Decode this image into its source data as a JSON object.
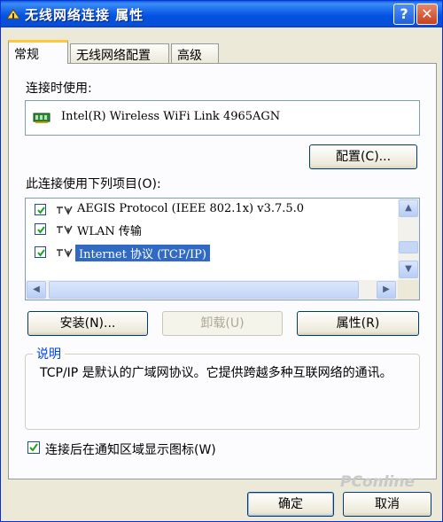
{
  "window": {
    "title": "无线网络连接 属性",
    "help_glyph": "?",
    "close_glyph": "✕"
  },
  "tabs": [
    {
      "label": "常规",
      "active": true
    },
    {
      "label": "无线网络配置",
      "active": false
    },
    {
      "label": "高级",
      "active": false
    }
  ],
  "general": {
    "connect_using_label": "连接时使用:",
    "device_name": "Intel(R) Wireless WiFi Link 4965AGN",
    "configure_button": "配置(C)...",
    "items_label": "此连接使用下列项目(O):",
    "items": [
      {
        "label": "AEGIS Protocol (IEEE 802.1x) v3.7.5.0",
        "checked": true,
        "selected": false
      },
      {
        "label": "WLAN 传输",
        "checked": true,
        "selected": false
      },
      {
        "label": "Internet 协议 (TCP/IP)",
        "checked": true,
        "selected": true
      }
    ],
    "install_button": "安装(N)...",
    "uninstall_button": "卸载(U)",
    "properties_button": "属性(R)",
    "description_title": "说明",
    "description_text": "TCP/IP 是默认的广域网协议。它提供跨越多种互联网络的通讯。",
    "show_icon_label": "连接后在通知区域显示图标(W)",
    "show_icon_checked": true
  },
  "footer": {
    "ok_button": "确定",
    "cancel_button": "取消"
  },
  "watermark": "PConline",
  "colors": {
    "title_bar": "#0a5fe0",
    "selection": "#316ac5",
    "group_title": "#0046d5"
  }
}
